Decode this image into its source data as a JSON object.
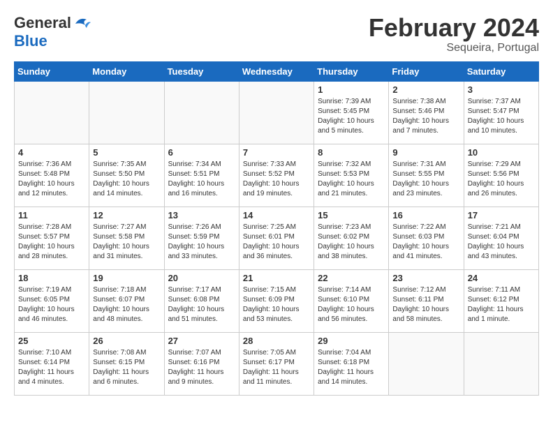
{
  "header": {
    "logo_general": "General",
    "logo_blue": "Blue",
    "title": "February 2024",
    "subtitle": "Sequeira, Portugal"
  },
  "days_of_week": [
    "Sunday",
    "Monday",
    "Tuesday",
    "Wednesday",
    "Thursday",
    "Friday",
    "Saturday"
  ],
  "weeks": [
    [
      {
        "day": "",
        "info": ""
      },
      {
        "day": "",
        "info": ""
      },
      {
        "day": "",
        "info": ""
      },
      {
        "day": "",
        "info": ""
      },
      {
        "day": "1",
        "info": "Sunrise: 7:39 AM\nSunset: 5:45 PM\nDaylight: 10 hours\nand 5 minutes."
      },
      {
        "day": "2",
        "info": "Sunrise: 7:38 AM\nSunset: 5:46 PM\nDaylight: 10 hours\nand 7 minutes."
      },
      {
        "day": "3",
        "info": "Sunrise: 7:37 AM\nSunset: 5:47 PM\nDaylight: 10 hours\nand 10 minutes."
      }
    ],
    [
      {
        "day": "4",
        "info": "Sunrise: 7:36 AM\nSunset: 5:48 PM\nDaylight: 10 hours\nand 12 minutes."
      },
      {
        "day": "5",
        "info": "Sunrise: 7:35 AM\nSunset: 5:50 PM\nDaylight: 10 hours\nand 14 minutes."
      },
      {
        "day": "6",
        "info": "Sunrise: 7:34 AM\nSunset: 5:51 PM\nDaylight: 10 hours\nand 16 minutes."
      },
      {
        "day": "7",
        "info": "Sunrise: 7:33 AM\nSunset: 5:52 PM\nDaylight: 10 hours\nand 19 minutes."
      },
      {
        "day": "8",
        "info": "Sunrise: 7:32 AM\nSunset: 5:53 PM\nDaylight: 10 hours\nand 21 minutes."
      },
      {
        "day": "9",
        "info": "Sunrise: 7:31 AM\nSunset: 5:55 PM\nDaylight: 10 hours\nand 23 minutes."
      },
      {
        "day": "10",
        "info": "Sunrise: 7:29 AM\nSunset: 5:56 PM\nDaylight: 10 hours\nand 26 minutes."
      }
    ],
    [
      {
        "day": "11",
        "info": "Sunrise: 7:28 AM\nSunset: 5:57 PM\nDaylight: 10 hours\nand 28 minutes."
      },
      {
        "day": "12",
        "info": "Sunrise: 7:27 AM\nSunset: 5:58 PM\nDaylight: 10 hours\nand 31 minutes."
      },
      {
        "day": "13",
        "info": "Sunrise: 7:26 AM\nSunset: 5:59 PM\nDaylight: 10 hours\nand 33 minutes."
      },
      {
        "day": "14",
        "info": "Sunrise: 7:25 AM\nSunset: 6:01 PM\nDaylight: 10 hours\nand 36 minutes."
      },
      {
        "day": "15",
        "info": "Sunrise: 7:23 AM\nSunset: 6:02 PM\nDaylight: 10 hours\nand 38 minutes."
      },
      {
        "day": "16",
        "info": "Sunrise: 7:22 AM\nSunset: 6:03 PM\nDaylight: 10 hours\nand 41 minutes."
      },
      {
        "day": "17",
        "info": "Sunrise: 7:21 AM\nSunset: 6:04 PM\nDaylight: 10 hours\nand 43 minutes."
      }
    ],
    [
      {
        "day": "18",
        "info": "Sunrise: 7:19 AM\nSunset: 6:05 PM\nDaylight: 10 hours\nand 46 minutes."
      },
      {
        "day": "19",
        "info": "Sunrise: 7:18 AM\nSunset: 6:07 PM\nDaylight: 10 hours\nand 48 minutes."
      },
      {
        "day": "20",
        "info": "Sunrise: 7:17 AM\nSunset: 6:08 PM\nDaylight: 10 hours\nand 51 minutes."
      },
      {
        "day": "21",
        "info": "Sunrise: 7:15 AM\nSunset: 6:09 PM\nDaylight: 10 hours\nand 53 minutes."
      },
      {
        "day": "22",
        "info": "Sunrise: 7:14 AM\nSunset: 6:10 PM\nDaylight: 10 hours\nand 56 minutes."
      },
      {
        "day": "23",
        "info": "Sunrise: 7:12 AM\nSunset: 6:11 PM\nDaylight: 10 hours\nand 58 minutes."
      },
      {
        "day": "24",
        "info": "Sunrise: 7:11 AM\nSunset: 6:12 PM\nDaylight: 11 hours\nand 1 minute."
      }
    ],
    [
      {
        "day": "25",
        "info": "Sunrise: 7:10 AM\nSunset: 6:14 PM\nDaylight: 11 hours\nand 4 minutes."
      },
      {
        "day": "26",
        "info": "Sunrise: 7:08 AM\nSunset: 6:15 PM\nDaylight: 11 hours\nand 6 minutes."
      },
      {
        "day": "27",
        "info": "Sunrise: 7:07 AM\nSunset: 6:16 PM\nDaylight: 11 hours\nand 9 minutes."
      },
      {
        "day": "28",
        "info": "Sunrise: 7:05 AM\nSunset: 6:17 PM\nDaylight: 11 hours\nand 11 minutes."
      },
      {
        "day": "29",
        "info": "Sunrise: 7:04 AM\nSunset: 6:18 PM\nDaylight: 11 hours\nand 14 minutes."
      },
      {
        "day": "",
        "info": ""
      },
      {
        "day": "",
        "info": ""
      }
    ]
  ]
}
